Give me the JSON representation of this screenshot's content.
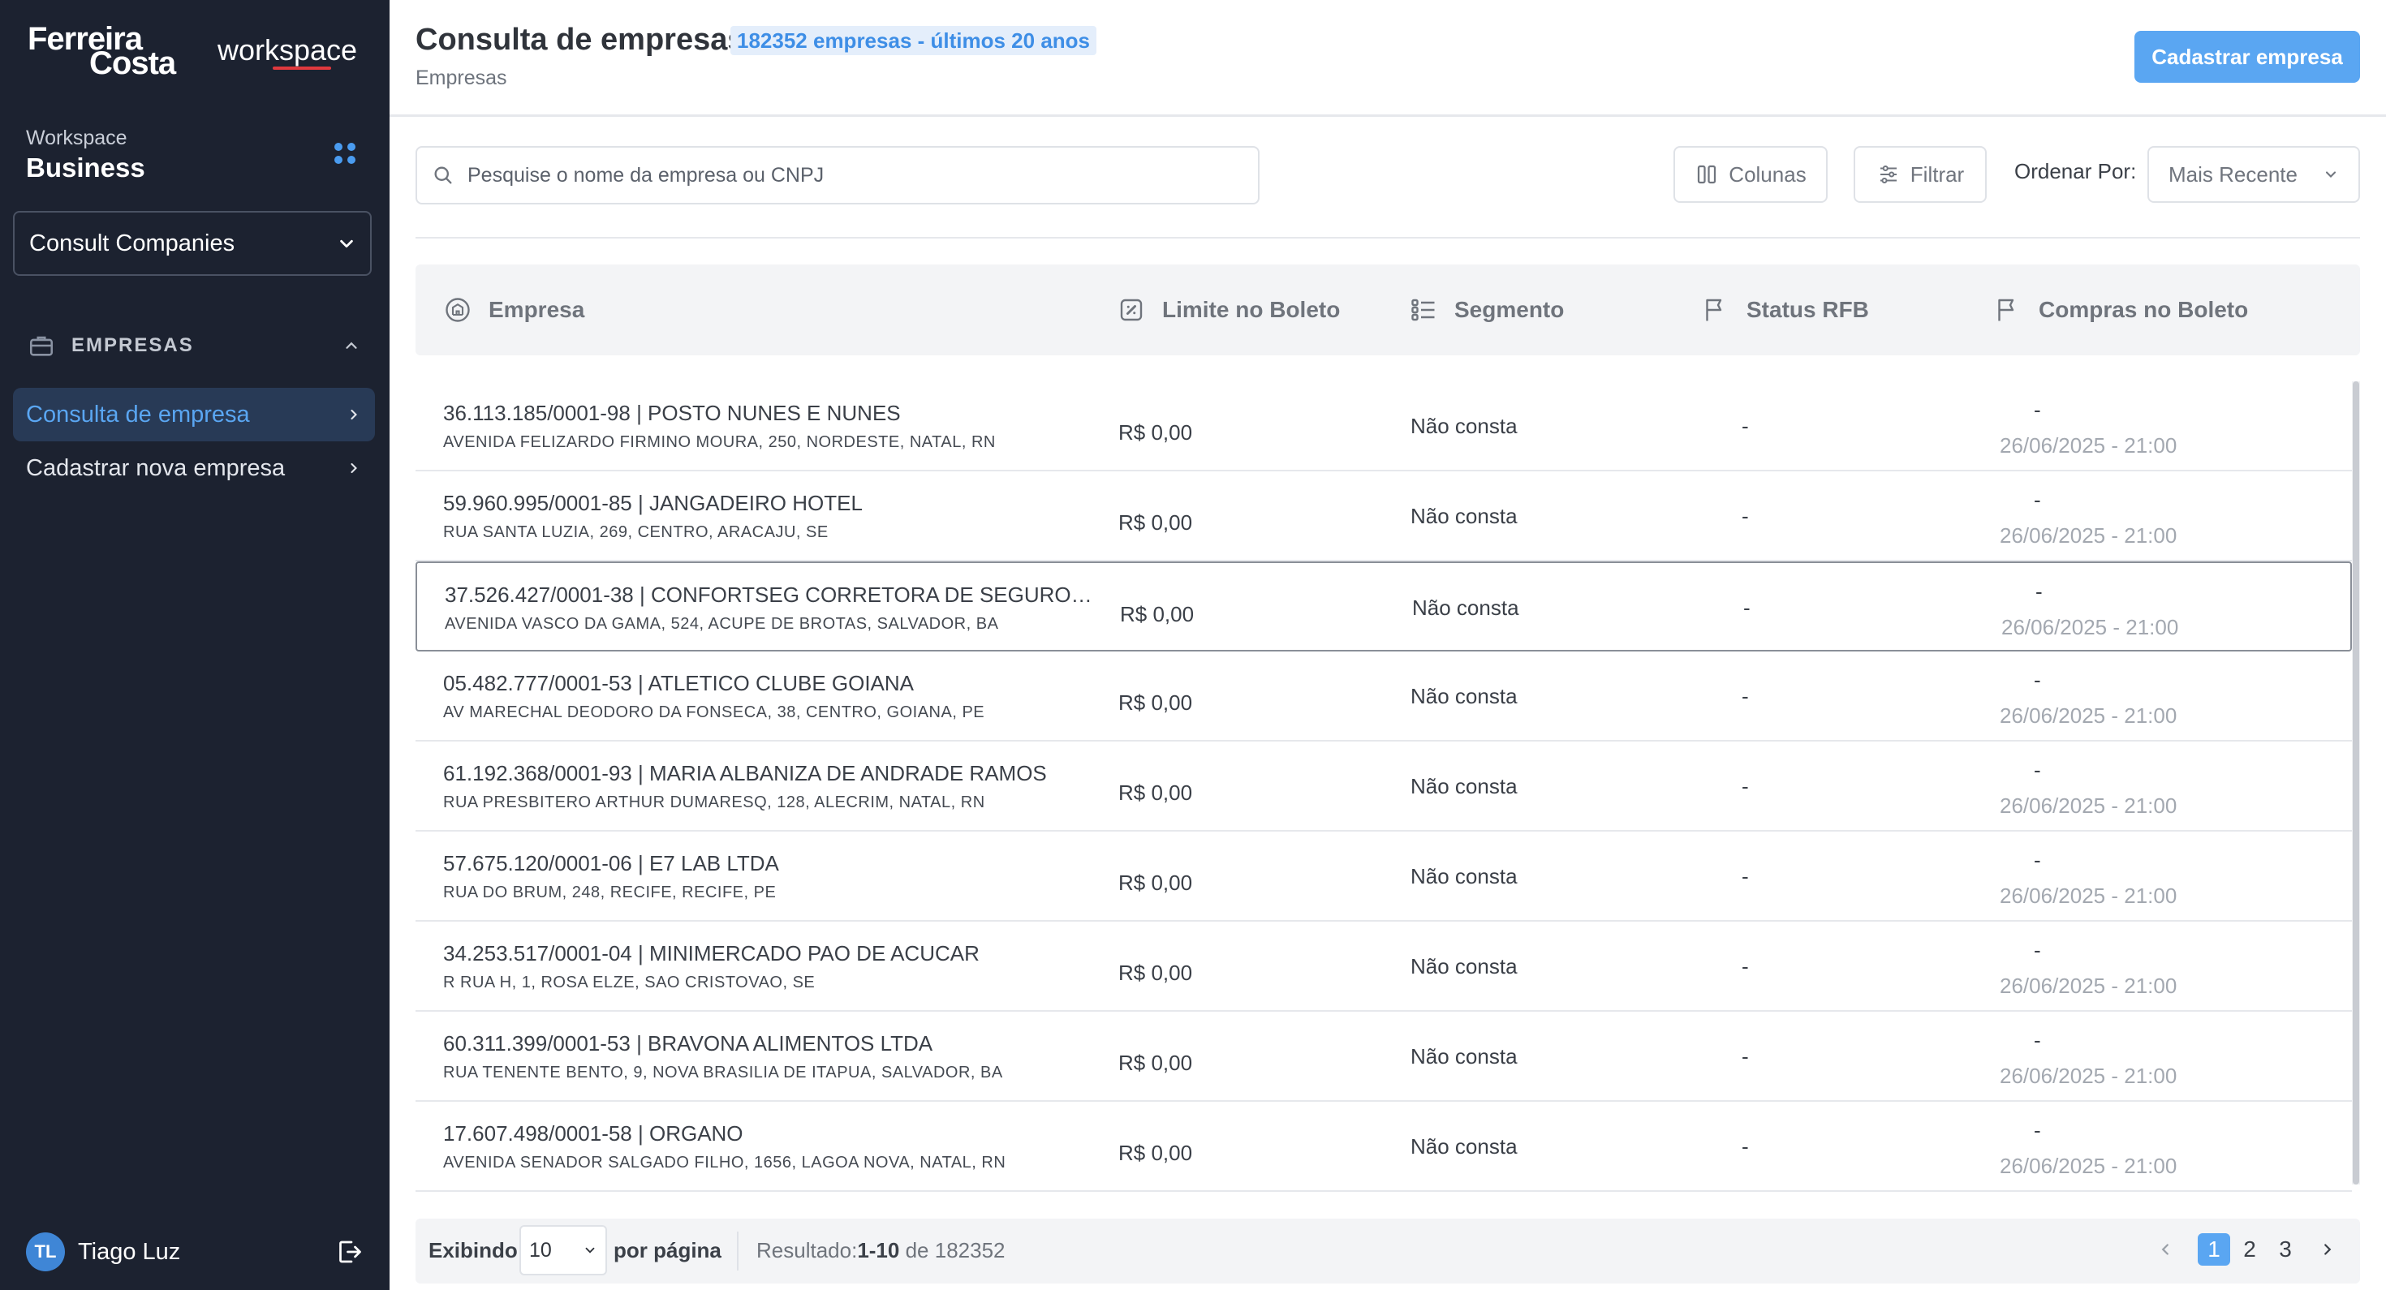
{
  "brand": {
    "line1": "Ferreira",
    "line2": "Costa",
    "product": "workspace"
  },
  "workspace": {
    "label": "Workspace",
    "name": "Business",
    "selector_value": "Consult Companies"
  },
  "nav": {
    "section_title": "EMPRESAS",
    "items": [
      {
        "label": "Consulta de empresa",
        "active": true
      },
      {
        "label": "Cadastrar nova empresa",
        "active": false
      }
    ]
  },
  "user": {
    "initials": "TL",
    "name": "Tiago Luz"
  },
  "header": {
    "title": "Consulta de empresas",
    "badge": "182352 empresas - últimos 20 anos",
    "breadcrumb": "Empresas",
    "primary_button": "Cadastrar empresa"
  },
  "toolbar": {
    "search_placeholder": "Pesquise o nome da empresa ou CNPJ",
    "columns_button": "Colunas",
    "filter_button": "Filtrar",
    "sort_label": "Ordenar Por:",
    "sort_value": "Mais Recente"
  },
  "table": {
    "columns": [
      "Empresa",
      "Limite no Boleto",
      "Segmento",
      "Status RFB",
      "Compras no Boleto"
    ],
    "rows": [
      {
        "name": "36.113.185/0001-98 | POSTO NUNES E NUNES",
        "address": "AVENIDA FELIZARDO FIRMINO MOURA, 250, NORDESTE, NATAL, RN",
        "limit": "R$ 0,00",
        "segment": "Não consta",
        "rfb": "-",
        "purchases": "-",
        "date": "26/06/2025 - 21:00"
      },
      {
        "name": "59.960.995/0001-85 | JANGADEIRO HOTEL",
        "address": "RUA SANTA LUZIA, 269, CENTRO, ARACAJU, SE",
        "limit": "R$ 0,00",
        "segment": "Não consta",
        "rfb": "-",
        "purchases": "-",
        "date": "26/06/2025 - 21:00"
      },
      {
        "name": "37.526.427/0001-38 | CONFORTSEG CORRETORA DE SEGUROS L...",
        "address": "AVENIDA VASCO DA GAMA, 524, ACUPE DE BROTAS, SALVADOR, BA",
        "limit": "R$ 0,00",
        "segment": "Não consta",
        "rfb": "-",
        "purchases": "-",
        "date": "26/06/2025 - 21:00"
      },
      {
        "name": "05.482.777/0001-53 | ATLETICO CLUBE GOIANA",
        "address": "AV MARECHAL DEODORO DA FONSECA, 38, CENTRO, GOIANA, PE",
        "limit": "R$ 0,00",
        "segment": "Não consta",
        "rfb": "-",
        "purchases": "-",
        "date": "26/06/2025 - 21:00"
      },
      {
        "name": "61.192.368/0001-93 | MARIA ALBANIZA DE ANDRADE RAMOS",
        "address": "RUA PRESBITERO ARTHUR DUMARESQ, 128, ALECRIM, NATAL, RN",
        "limit": "R$ 0,00",
        "segment": "Não consta",
        "rfb": "-",
        "purchases": "-",
        "date": "26/06/2025 - 21:00"
      },
      {
        "name": "57.675.120/0001-06 | E7 LAB LTDA",
        "address": "RUA DO BRUM, 248, RECIFE, RECIFE, PE",
        "limit": "R$ 0,00",
        "segment": "Não consta",
        "rfb": "-",
        "purchases": "-",
        "date": "26/06/2025 - 21:00"
      },
      {
        "name": "34.253.517/0001-04 | MINIMERCADO PAO DE ACUCAR",
        "address": "R RUA H, 1, ROSA ELZE, SAO CRISTOVAO, SE",
        "limit": "R$ 0,00",
        "segment": "Não consta",
        "rfb": "-",
        "purchases": "-",
        "date": "26/06/2025 - 21:00"
      },
      {
        "name": "60.311.399/0001-53 | BRAVONA ALIMENTOS LTDA",
        "address": "RUA TENENTE BENTO, 9, NOVA BRASILIA DE ITAPUA, SALVADOR, BA",
        "limit": "R$ 0,00",
        "segment": "Não consta",
        "rfb": "-",
        "purchases": "-",
        "date": "26/06/2025 - 21:00"
      },
      {
        "name": "17.607.498/0001-58 | ORGANO",
        "address": "AVENIDA SENADOR SALGADO FILHO, 1656, LAGOA NOVA, NATAL, RN",
        "limit": "R$ 0,00",
        "segment": "Não consta",
        "rfb": "-",
        "purchases": "-",
        "date": "26/06/2025 - 21:00"
      }
    ]
  },
  "pagination": {
    "showing_label": "Exibindo",
    "page_size": "10",
    "per_page_label": "por página",
    "result_label": "Resultado:",
    "result_range": "1-10",
    "result_total": "de 182352",
    "pages": [
      "1",
      "2",
      "3"
    ]
  },
  "colors": {
    "sidebar_bg": "#1c2230",
    "accent": "#5aa6f2",
    "brand_red": "#e0393e"
  }
}
